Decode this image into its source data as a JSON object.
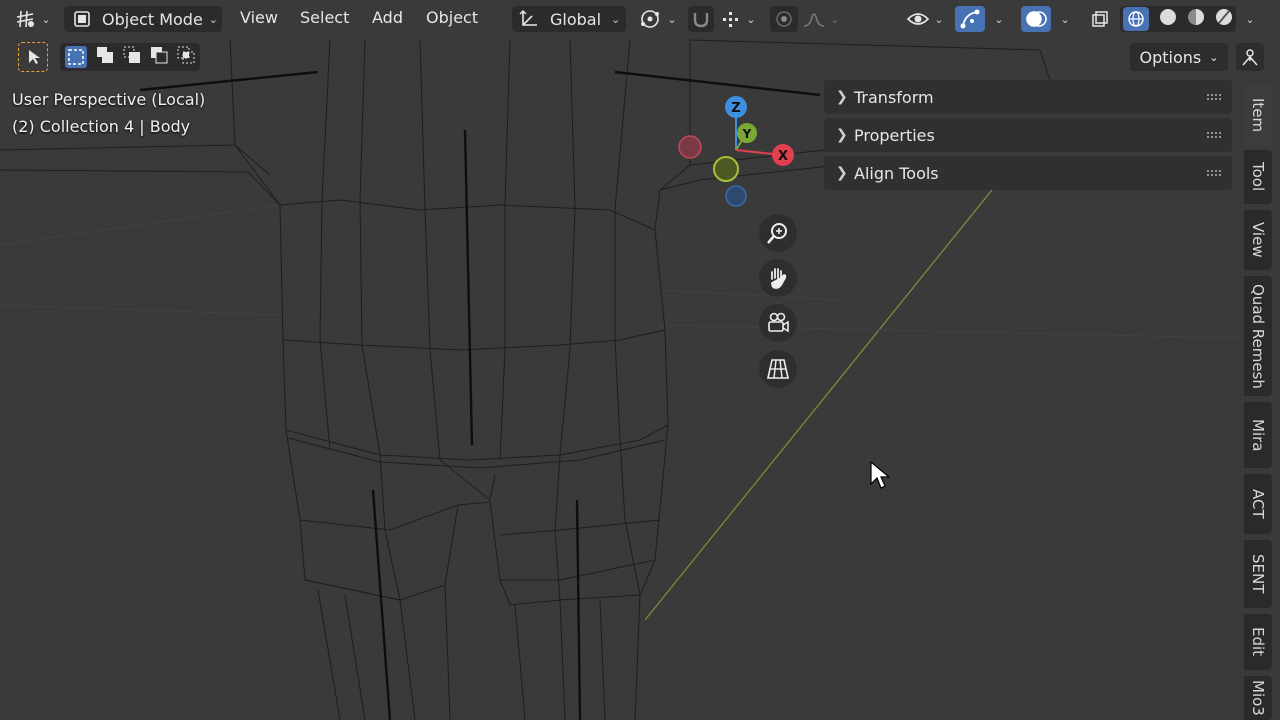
{
  "header": {
    "editor_icon": "editor-type-icon",
    "mode_label": "Object Mode",
    "menus": [
      "View",
      "Select",
      "Add",
      "Object"
    ],
    "transform_orientation": "Global"
  },
  "viewport_overlay": {
    "perspective": "User Perspective (Local)",
    "collection": "(2) Collection 4 | Body"
  },
  "gizmo": {
    "z": "Z",
    "y": "Y",
    "x": "X"
  },
  "options_label": "Options",
  "panel": {
    "sections": [
      {
        "label": "Transform"
      },
      {
        "label": "Properties"
      },
      {
        "label": "Align Tools"
      }
    ]
  },
  "tabs": [
    "Item",
    "Tool",
    "View",
    "Quad Remesh",
    "Mira",
    "ACT",
    "SENT",
    "Edit",
    "Mio3"
  ],
  "colors": {
    "background": "#3a3a3a",
    "accent": "#4772b3",
    "axis_x": "#e0404f",
    "axis_y": "#7ca836",
    "axis_z": "#3f8fe0",
    "axis_line_y": "#7d8a3a",
    "select_outline": "#f0a13a"
  }
}
